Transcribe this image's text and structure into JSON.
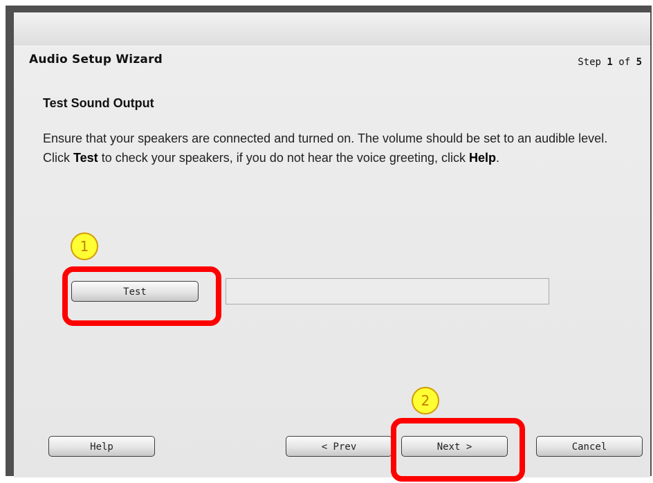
{
  "wizard": {
    "title": "Audio Setup Wizard",
    "step_prefix": "Step ",
    "step_current": "1",
    "step_of": " of ",
    "step_total": "5"
  },
  "content": {
    "section_title": "Test Sound Output",
    "description": {
      "part1": "Ensure that your speakers are connected and turned on. The volume should be set to an audible level. Click ",
      "test_word": "Test",
      "part2": " to check your speakers, if you do not hear the voice greeting, click ",
      "help_word": "Help",
      "part3": "."
    }
  },
  "controls": {
    "test_label": "Test",
    "output_value": ""
  },
  "footer": {
    "help_label": "Help",
    "prev_label": "< Prev",
    "next_label": "Next >",
    "cancel_label": "Cancel"
  },
  "annotations": {
    "callout_1": "1",
    "callout_2": "2",
    "highlight_color": "#ff0000",
    "callout_color": "#ffff33"
  }
}
